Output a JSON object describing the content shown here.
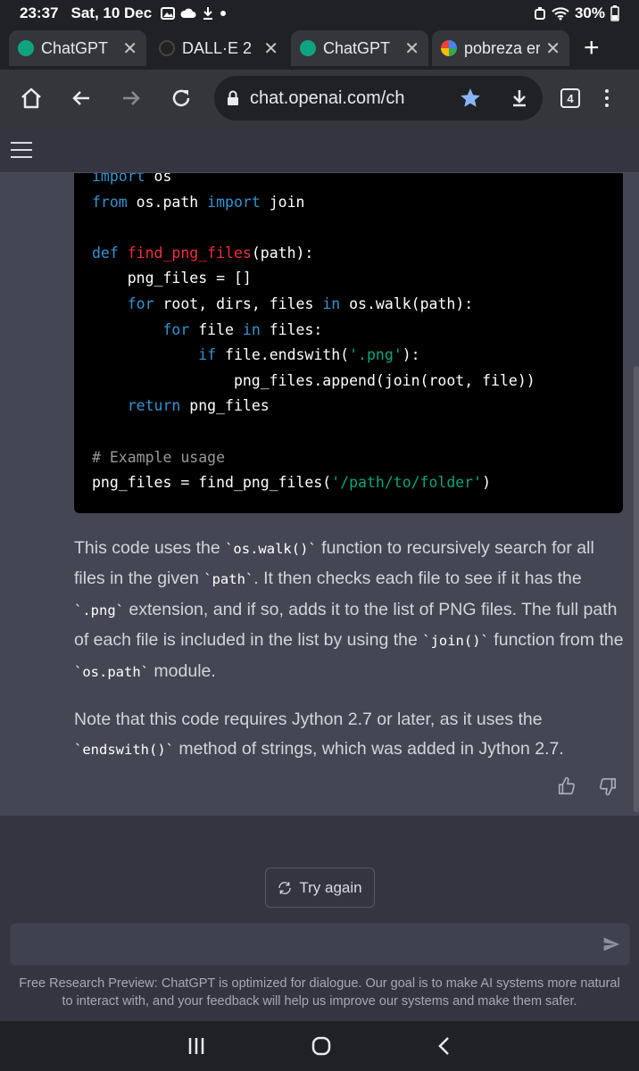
{
  "status": {
    "time": "23:37",
    "date": "Sat, 10 Dec",
    "battery": "30%"
  },
  "tabs": [
    {
      "label": "ChatGPT",
      "icon": "openai-icon",
      "active": true
    },
    {
      "label": "DALL·E 2",
      "icon": "openai-icon",
      "active": false
    },
    {
      "label": "ChatGPT",
      "icon": "openai-icon",
      "active": true
    },
    {
      "label": "pobreza er",
      "icon": "google-icon",
      "active": false
    }
  ],
  "browser": {
    "url": "chat.openai.com/ch",
    "tab_count": "4"
  },
  "code": {
    "lines": [
      [
        {
          "t": "import",
          "c": "kw"
        },
        {
          "t": " os",
          "c": ""
        }
      ],
      [
        {
          "t": "from",
          "c": "kw"
        },
        {
          "t": " os.path ",
          "c": ""
        },
        {
          "t": "import",
          "c": "kw"
        },
        {
          "t": " join",
          "c": ""
        }
      ],
      [],
      [
        {
          "t": "def",
          "c": "kw"
        },
        {
          "t": " ",
          "c": ""
        },
        {
          "t": "find_png_files",
          "c": "fn"
        },
        {
          "t": "(path):",
          "c": ""
        }
      ],
      [
        {
          "t": "    png_files = []",
          "c": ""
        }
      ],
      [
        {
          "t": "    ",
          "c": ""
        },
        {
          "t": "for",
          "c": "kw"
        },
        {
          "t": " root, dirs, files ",
          "c": ""
        },
        {
          "t": "in",
          "c": "kw"
        },
        {
          "t": " os.walk(path):",
          "c": ""
        }
      ],
      [
        {
          "t": "        ",
          "c": ""
        },
        {
          "t": "for",
          "c": "kw"
        },
        {
          "t": " file ",
          "c": ""
        },
        {
          "t": "in",
          "c": "kw"
        },
        {
          "t": " files:",
          "c": ""
        }
      ],
      [
        {
          "t": "            ",
          "c": ""
        },
        {
          "t": "if",
          "c": "kw"
        },
        {
          "t": " file.endswith(",
          "c": ""
        },
        {
          "t": "'.png'",
          "c": "str"
        },
        {
          "t": "):",
          "c": ""
        }
      ],
      [
        {
          "t": "                png_files.append(join(root, file))",
          "c": ""
        }
      ],
      [
        {
          "t": "    ",
          "c": ""
        },
        {
          "t": "return",
          "c": "kw"
        },
        {
          "t": " png_files",
          "c": ""
        }
      ],
      [],
      [
        {
          "t": "# Example usage",
          "c": "cm"
        }
      ],
      [
        {
          "t": "png_files = find_png_files(",
          "c": ""
        },
        {
          "t": "'/path/to/folder'",
          "c": "str"
        },
        {
          "t": ")",
          "c": ""
        }
      ]
    ]
  },
  "message": {
    "paragraph1": [
      {
        "t": "This code uses the ",
        "code": false
      },
      {
        "t": "`os.walk()`",
        "code": true
      },
      {
        "t": " function to recursively search for all files in the given ",
        "code": false
      },
      {
        "t": "`path`",
        "code": true
      },
      {
        "t": ". It then checks each file to see if it has the ",
        "code": false
      },
      {
        "t": "`.png`",
        "code": true
      },
      {
        "t": " extension, and if so, adds it to the list of PNG files. The full path of each file is included in the list by using the ",
        "code": false
      },
      {
        "t": "`join()`",
        "code": true
      },
      {
        "t": " function from the ",
        "code": false
      },
      {
        "t": "`os.path`",
        "code": true
      },
      {
        "t": " module.",
        "code": false
      }
    ],
    "paragraph2": [
      {
        "t": "Note that this code requires Jython 2.7 or later, as it uses the ",
        "code": false
      },
      {
        "t": "`endswith()`",
        "code": true
      },
      {
        "t": " method of strings, which was added in Jython 2.7.",
        "code": false
      }
    ]
  },
  "actions": {
    "try_again": "Try again"
  },
  "input": {
    "value": "",
    "placeholder": ""
  },
  "footer": "Free Research Preview: ChatGPT is optimized for dialogue. Our goal is to make AI systems more natural to interact with, and your feedback will help us improve our systems and make them safer."
}
